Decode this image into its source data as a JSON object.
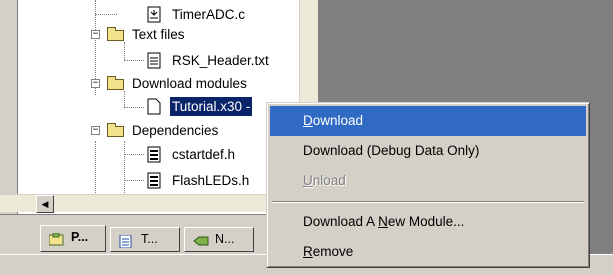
{
  "tree": {
    "items": [
      {
        "label": "TimerADC.c",
        "icon": "source-file-icon"
      },
      {
        "label": "Text files",
        "icon": "folder-icon"
      },
      {
        "label": "RSK_Header.txt",
        "icon": "text-file-icon"
      },
      {
        "label": "Download modules",
        "icon": "folder-icon"
      },
      {
        "label": "Tutorial.x30 -",
        "icon": "file-icon",
        "selected": true
      },
      {
        "label": "Dependencies",
        "icon": "folder-icon"
      },
      {
        "label": "cstartdef.h",
        "icon": "header-file-icon"
      },
      {
        "label": "FlashLEDs.h",
        "icon": "header-file-icon"
      }
    ]
  },
  "tabs": [
    {
      "label": "P...",
      "icon": "projects-tab-icon",
      "active": true
    },
    {
      "label": "T...",
      "icon": "templates-tab-icon",
      "active": false
    },
    {
      "label": "N...",
      "icon": "navigation-tab-icon",
      "active": false
    }
  ],
  "context_menu": {
    "items": [
      {
        "pre": "",
        "u": "D",
        "post": "ownload",
        "state": "highlighted"
      },
      {
        "pre": "Download (Debug Data Only)",
        "u": "",
        "post": "",
        "state": "normal"
      },
      {
        "pre": "",
        "u": "U",
        "post": "nload",
        "state": "disabled"
      },
      {
        "pre": "Download A ",
        "u": "N",
        "post": "ew Module...",
        "state": "normal"
      },
      {
        "pre": "",
        "u": "R",
        "post": "emove",
        "state": "normal"
      }
    ]
  },
  "colors": {
    "menu_highlight": "#316ac5",
    "selection": "#0a246a",
    "face": "#d4d0c8",
    "workspace": "#808080"
  }
}
